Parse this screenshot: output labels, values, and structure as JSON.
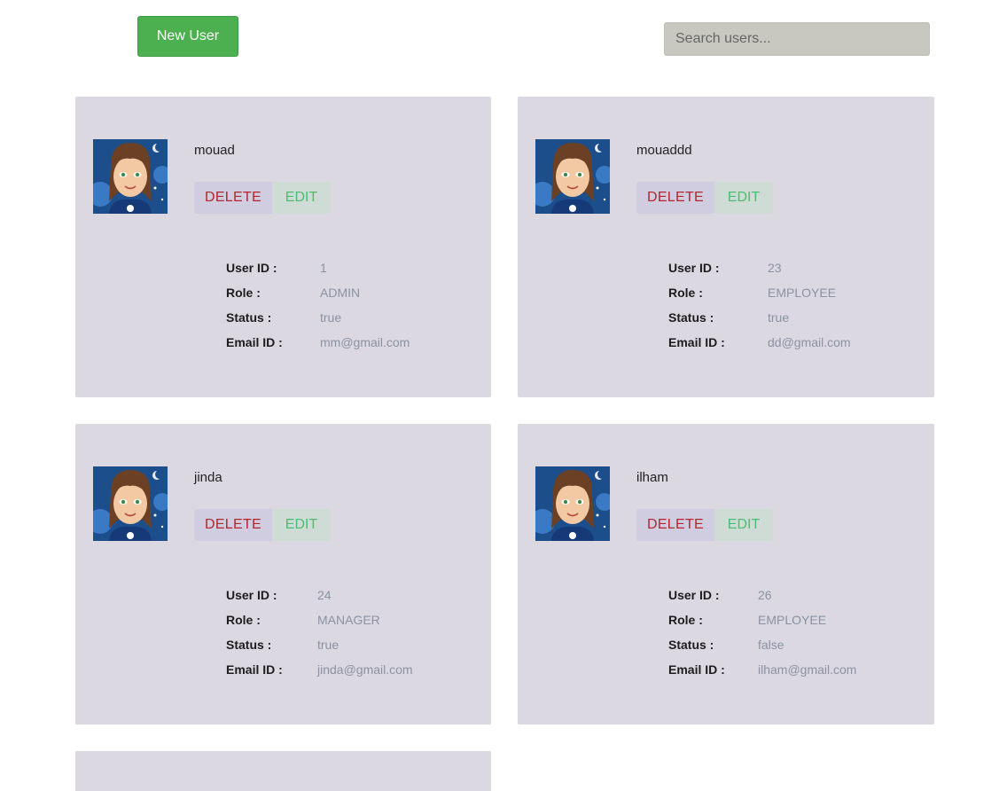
{
  "toolbar": {
    "new_user_label": "New User",
    "search_placeholder": "Search users..."
  },
  "labels": {
    "user_id": "User ID :",
    "role": "Role :",
    "status": "Status :",
    "email": "Email ID :",
    "delete": "DELETE",
    "edit": "EDIT"
  },
  "users": [
    {
      "name": "mouad",
      "id": "1",
      "role": "ADMIN",
      "status": "true",
      "email": "mm@gmail.com"
    },
    {
      "name": "mouaddd",
      "id": "23",
      "role": "EMPLOYEE",
      "status": "true",
      "email": "dd@gmail.com"
    },
    {
      "name": "jinda",
      "id": "24",
      "role": "MANAGER",
      "status": "true",
      "email": "jinda@gmail.com"
    },
    {
      "name": "ilham",
      "id": "26",
      "role": "EMPLOYEE",
      "status": "false",
      "email": "ilham@gmail.com"
    }
  ],
  "colors": {
    "primary_button": "#4caf50",
    "card_bg": "#dbd8e1",
    "delete_text": "#b5252f",
    "edit_text": "#4cbc73"
  }
}
